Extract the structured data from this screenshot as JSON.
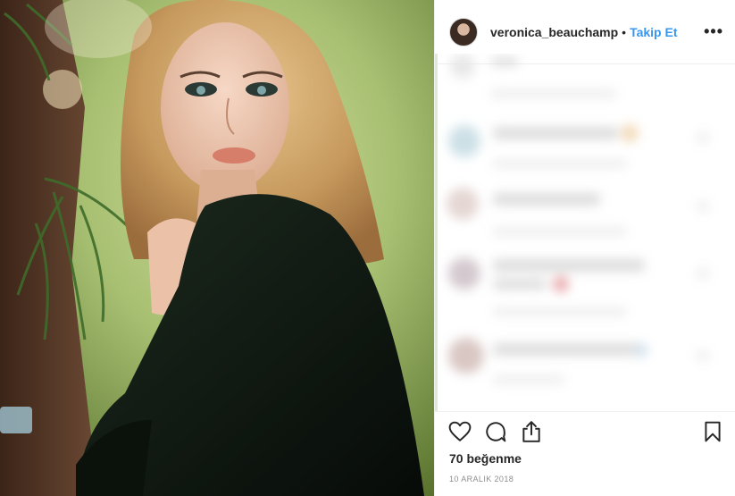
{
  "post": {
    "username": "veronica_beauchamp",
    "separator": "•",
    "follow_label": "Takip Et",
    "more_label": "•••",
    "likes_text": "70 beğenme",
    "date_text": "10 ARALIK 2018"
  },
  "icons": {
    "like": "heart-icon",
    "comment": "comment-icon",
    "share": "share-icon",
    "save": "bookmark-icon",
    "more": "more-options-icon"
  },
  "colors": {
    "accent": "#3897f0",
    "text": "#262626",
    "muted": "#8e8e8e",
    "border": "#efefef"
  }
}
